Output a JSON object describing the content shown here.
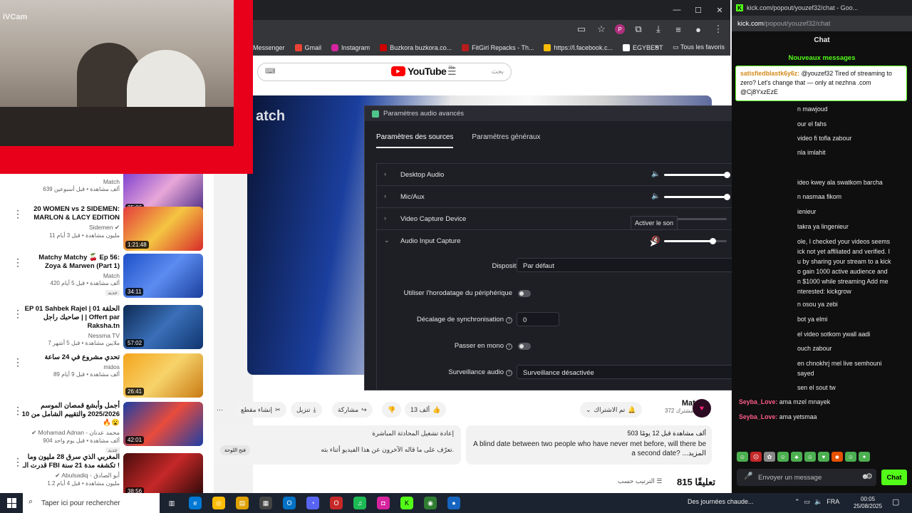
{
  "browser": {
    "bookmarks": [
      "Messenger",
      "Gmail",
      "Instagram",
      "Buzkora buzkora.co...",
      "FitGirl Repacks - Th...",
      "https://l.facebook.c...",
      "EGYBEST"
    ],
    "bookmarks_more": "»",
    "favorites": "Tous les favoris",
    "window_controls": [
      "—",
      "☐",
      "✕"
    ]
  },
  "youtube": {
    "search_placeholder": "بحث",
    "logo_text": "YouTube",
    "logo_suffix": "TN",
    "player_watermark": "atch",
    "channel_name": "Match",
    "channel_subs": "372 ألف مشترك",
    "subscribe_label": "تم الاشتراك",
    "like_count": "13 ألف",
    "share_label": "مشاركة",
    "download_label": "تنزيل",
    "clip_label": "إنشاء مقطع",
    "desc_meta": "503 ألف مشاهدة  قبل 12 يومًا",
    "desc_text": "A blind date between two people who have never met before, will there be a second date? ...المزيد",
    "chat_replay_title": "إعادة تشغيل المحادثة المباشرة",
    "chat_replay_sub": "تعرّف على ما قاله الآخرون عن هذا الفيديو أثناء بثه.",
    "chat_replay_button": "فتح اللوحة",
    "comments_count": "815 تعليقًا",
    "sort_label": "الترتيب حسب",
    "related": [
      {
        "title": "",
        "channel": "Match",
        "views": "639 ألف مشاهدة • قبل أسبوعين",
        "duration": "25:06",
        "verified": false,
        "new": false
      },
      {
        "title": "20 WOMEN vs 2 SIDEMEN: MARLON & LACY EDITION",
        "channel": "Sidemen",
        "views": "11 مليون مشاهدة • قبل 3 أيام",
        "duration": "1:21:48",
        "verified": true,
        "new": false
      },
      {
        "title": "Matchy Matchy 🍒 Ep 56: Zoya & Marwen (Part 1)",
        "channel": "Match",
        "views": "420 ألف مشاهدة • قبل 5 أيام",
        "duration": "34:11",
        "verified": false,
        "new": true
      },
      {
        "title": "EP 01 Sahbek Rajel | الحلقة 01 | صاحبك راجل | Offert par Raksha.tn",
        "channel": "Nessma TV",
        "views": "7 ملايين مشاهدة • قبل 5 أشهر",
        "duration": "57:02",
        "verified": false,
        "new": false
      },
      {
        "title": "تحدي مشروع في 24 ساعة",
        "channel": "midos",
        "views": "89 ألف مشاهدة • قبل 9 أيام",
        "duration": "26:41",
        "verified": false,
        "new": false
      },
      {
        "title": "أجمل وأبشع قمصان الموسم 2025/2026 والتقييم الشامل من 10 🔥😮",
        "channel": "Mohamad Adnan - محمد عدنان",
        "views": "904 ألف مشاهدة • قبل يوم واحد",
        "duration": "42:01",
        "verified": true,
        "new": true
      },
      {
        "title": "المغربي الذي سرق 28 مليون وما قدرت الـ FBI تكشفه مدة 21 سنة !",
        "channel": "Abulsadiq - أبو الصادق",
        "views": "1.2 مليون مشاهدة • قبل 4 أيام",
        "duration": "38:56",
        "verified": true,
        "new": false
      }
    ]
  },
  "webcam": {
    "label": "iVCam"
  },
  "obs": {
    "title": "Paramètres audio avancés",
    "tabs": [
      "Paramètres des sources",
      "Paramètres généraux"
    ],
    "sources": [
      {
        "name": "Desktop Audio",
        "volume": 100,
        "expanded": false
      },
      {
        "name": "Mic/Aux",
        "volume": 100,
        "expanded": false
      },
      {
        "name": "Video Capture Device",
        "volume": 10,
        "expanded": false
      },
      {
        "name": "Audio Input Capture",
        "volume": 77,
        "expanded": true
      }
    ],
    "device_label": "Dispositif",
    "device_value": "Par défaut",
    "timestamp_label": "Utiliser l'horodatage du périphérique",
    "sync_label": "Décalage de synchronisation",
    "sync_value": "0",
    "mono_label": "Passer en mono",
    "monitor_label": "Surveillance audio",
    "monitor_value": "Surveillance désactivée",
    "tooltip": "Activer le son"
  },
  "kick": {
    "window_title": "kick.com/popout/youzef32/chat - Goo...",
    "url_host": "kick.com",
    "url_path": "/popout/youzef32/chat",
    "header": "Chat",
    "new_messages": "Nouveaux messages",
    "pinned_user": "satisfiedblastk6y6z:",
    "pinned_text": "@youzef32 Tired of streaming to zero? Let's change that — only at nezhna .com @Cj8YxzEzE",
    "messages": [
      "n mawjoud",
      "our el fahs",
      "video fi tofla zabour",
      "nla imlahit",
      "ideo kwey ala swatkom barcha",
      "n nasmaa fikom",
      "ienieur",
      "takra ya lingenieur",
      "ole, I checked your videos seems",
      "ick not yet affiliated and verified. I",
      "u by sharing your stream to a kick",
      "o gain 1000 active audience and",
      "n $1000 while streaming Add me",
      "nterested: kickgrow",
      "n osou ya zebi",
      "bot ya elmi",
      "el video sotkom ywall aadi",
      "ouch zabour",
      "en chnokhrj mel live semhouni",
      "sayed",
      "sen el sout tw"
    ],
    "user_messages": [
      {
        "user": "Seyba_Love:",
        "text": "ama mzel mnayek"
      },
      {
        "user": "Seyba_Love:",
        "text": "ama yetsmaa"
      }
    ],
    "input_placeholder": "Envoyer un message",
    "send_label": "Chat"
  },
  "taskbar": {
    "search_placeholder": "Taper ici pour rechercher",
    "news": "Des journées chaude...",
    "lang": "FRA",
    "time": "00:05",
    "date": "25/08/2025"
  },
  "colors": {
    "kick_green": "#53fc18",
    "youtube_red": "#ff0000",
    "obs_bg": "#1e1f25",
    "webcam_border": "#e8001b"
  }
}
